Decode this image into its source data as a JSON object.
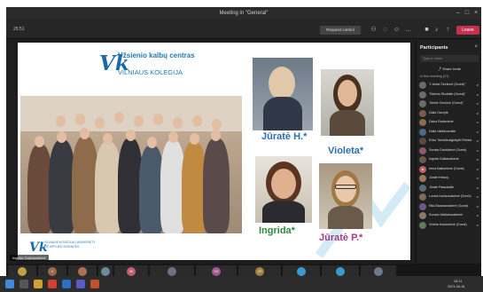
{
  "window": {
    "title": "Meeting in \"General\""
  },
  "header": {
    "timer": "25:51",
    "request_control": "Request control",
    "leave_label": "Leave",
    "icons": [
      "people-icon",
      "chat-icon",
      "reactions-icon",
      "more-icon",
      "camera-icon",
      "mic-icon",
      "share-icon"
    ]
  },
  "slide": {
    "logo_text": "Užsienio kalbų centras",
    "college": "VILNIAUS KOLEGIJA",
    "small_logo": "VILNIAUS KOLEGIJA | UNIVERSITY OF APPLIED SCIENCES",
    "names": {
      "jurate_h": "Jūratė H.*",
      "violeta": "Violeta*",
      "ingrida": "Ingrida*",
      "jurate_p": "Jūratė P.*"
    }
  },
  "presenter_tag": "Ingrida Galkauskienė",
  "participants": {
    "title": "Participants",
    "search_placeholder": "Type a name",
    "share_invite": "Share invite",
    "section": "In this meeting (21)",
    "items": [
      {
        "name": "\"L'Anita Čiurlionė (Guest)\"",
        "color": "#6b6b6b",
        "initials": ""
      },
      {
        "name": "\"Nidona Škuliatie (Guest)\"",
        "color": "#6b6b6b",
        "initials": ""
      },
      {
        "name": "\"Airidė Ovsrūnė (Guest)\"",
        "color": "#6b6b6b",
        "initials": ""
      },
      {
        "name": "Dalia Gavrytė",
        "color": "#7a5a4a",
        "initials": ""
      },
      {
        "name": "Daiva Radanienė",
        "color": "#8a6a50",
        "initials": ""
      },
      {
        "name": "Dalia Vaidikovnaitė",
        "color": "#4a6a8a",
        "initials": ""
      },
      {
        "name": "Erika Tamšiūnaigiūtytė-Petrikai...",
        "color": "#5a4a3a",
        "initials": ""
      },
      {
        "name": "Sonata Dauškienė (Guest)",
        "color": "#8a5a6a",
        "initials": ""
      },
      {
        "name": "Ingrida Galkauskienė",
        "color": "#6a5a4a",
        "initials": ""
      },
      {
        "name": "Irena Balkažienė (Guest)",
        "color": "#c06060",
        "initials": "IB"
      },
      {
        "name": "Jūratė Helooy",
        "color": "#9a7a5a",
        "initials": ""
      },
      {
        "name": "Jūratė Pataukaitė",
        "color": "#5a6a7a",
        "initials": ""
      },
      {
        "name": "Loreta Karūzauskienė (SonGuy)...",
        "color": "#7a6a5a",
        "initials": ""
      },
      {
        "name": "Rita Baranauskienė (Guest)",
        "color": "#6a5a8a",
        "initials": ""
      },
      {
        "name": "Sonata Vaišiakauskienė",
        "color": "#8a7a6a",
        "initials": ""
      },
      {
        "name": "Violeta Kaukulienė (Guest)",
        "color": "#5a7a5a",
        "initials": ""
      }
    ]
  },
  "strip": [
    {
      "label": "",
      "initials": "",
      "color": "#c0a040"
    },
    {
      "label": "",
      "initials": "V",
      "color": "#9a6a4a"
    },
    {
      "label": "",
      "initials": "",
      "color": "#b07050"
    },
    {
      "label": "",
      "initials": "",
      "color": "#6a8a9a"
    },
    {
      "label": "Irena Balkažienė (Guest)",
      "initials": "IB",
      "color": "#c06070"
    },
    {
      "label": "Dalia Vrublevskienė",
      "initials": "",
      "color": "#7a6a8a"
    },
    {
      "label": "Dalia Savrytė",
      "initials": "DG",
      "color": "#a05a8a"
    },
    {
      "label": "Vilja Šapokienė (Guest)",
      "initials": "VŠ",
      "color": "#a08040"
    },
    {
      "label": "",
      "initials": "",
      "color": "#3a9ad0"
    },
    {
      "label": "",
      "initials": "",
      "color": "#3a9ad0"
    },
    {
      "label": "",
      "initials": "",
      "color": "#6a7a8a"
    }
  ],
  "taskbar": {
    "time": "16:11",
    "date": "2021-04-16"
  }
}
